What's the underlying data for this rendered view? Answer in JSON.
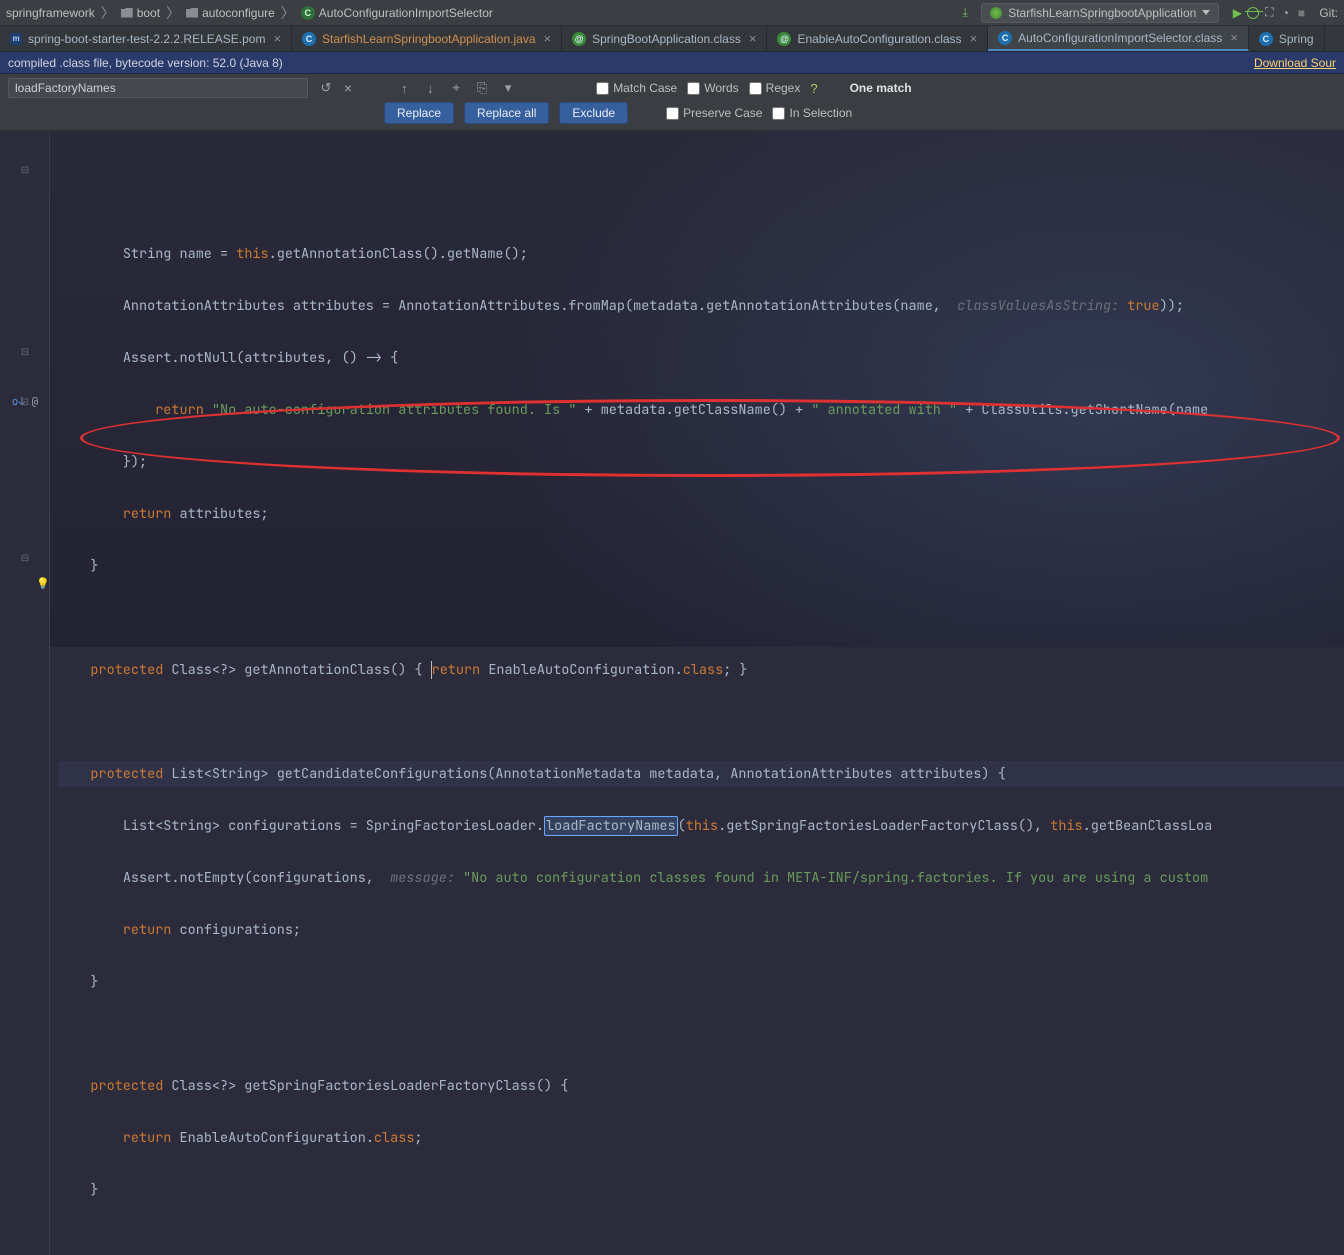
{
  "breadcrumbs": {
    "a": "springframework",
    "b": "boot",
    "c": "autoconfigure",
    "d": "AutoConfigurationImportSelector"
  },
  "run_config": {
    "name": "StarfishLearnSpringbootApplication"
  },
  "git": {
    "label": "Git:"
  },
  "tabs": {
    "t0": {
      "label": "spring-boot-starter-test-2.2.2.RELEASE.pom"
    },
    "t1": {
      "label": "StarfishLearnSpringbootApplication.java"
    },
    "t2": {
      "label": "SpringBootApplication.class"
    },
    "t3": {
      "label": "EnableAutoConfiguration.class"
    },
    "t4": {
      "label": "AutoConfigurationImportSelector.class"
    },
    "t5": {
      "label": "Spring"
    }
  },
  "notice": {
    "text": "compiled .class file, bytecode version: 52.0 (Java 8)",
    "download": "Download Sour"
  },
  "find": {
    "query": "loadFactoryNames",
    "match_count": "One match",
    "match_case": "Match Case",
    "words": "Words",
    "regex": "Regex",
    "preserve": "Preserve Case",
    "in_sel": "In Selection",
    "replace": "Replace",
    "replace_all": "Replace all",
    "exclude": "Exclude"
  },
  "code": {
    "l0a": "String name = ",
    "l0b": "this",
    "l0c": ".getAnnotationClass().getName();",
    "l1a": "AnnotationAttributes attributes = AnnotationAttributes.fromMap(metadata.getAnnotationAttributes(name, ",
    "l1ghost": " classValuesAsString: ",
    "l1b": "true",
    "l1c": "));",
    "l2a": "Assert.notNull(attributes, () -> {",
    "l3a": "return ",
    "l3s": "\"No auto-configuration attributes found. Is \"",
    "l3b": " + metadata.getClassName() + ",
    "l3s2": "\" annotated with \"",
    "l3c": " + ClassUtils.getShortName(name",
    "l4a": "});",
    "l5a": "return ",
    "l5b": "attributes;",
    "l6a": "}",
    "l7a": "protected ",
    "l7b": "Class<?> getAnnotationClass() { ",
    "l7c": "return ",
    "l7d": "EnableAutoConfiguration.",
    "l7e": "class",
    "l7f": "; }",
    "l8a": "protected ",
    "l8b": "List<String> getCandidateConfigurations(AnnotationMetadata metadata, AnnotationAttributes attributes) {",
    "l9a": "List<String> configurations = SpringFactoriesLoader.",
    "l9hl": "loadFactoryNames",
    "l9b": "(",
    "l9c": "this",
    "l9d": ".getSpringFactoriesLoaderFactoryClass(), ",
    "l9e": "this",
    "l9f": ".getBeanClassLoa",
    "l10a": "Assert.notEmpty(configurations, ",
    "l10ghost": " message: ",
    "l10s": "\"No auto configuration classes found in META-INF/spring.factories. If you are using a custom ",
    "l11a": "return ",
    "l11b": "configurations;",
    "l12a": "}",
    "l13a": "protected ",
    "l13b": "Class<?> getSpringFactoriesLoaderFactoryClass() {",
    "l14a": "return ",
    "l14b": "EnableAutoConfiguration.",
    "l14c": "class",
    "l14d": ";",
    "l15a": "}"
  }
}
